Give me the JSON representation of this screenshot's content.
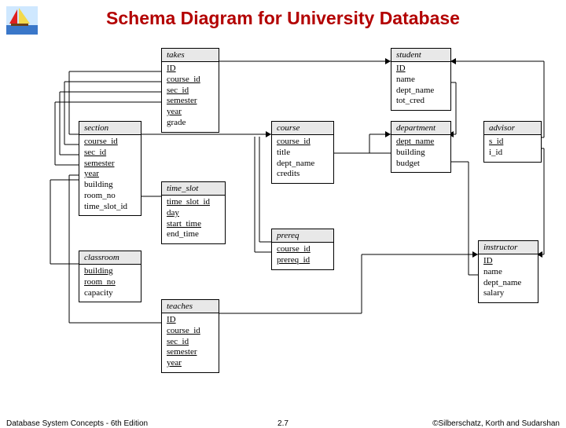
{
  "title": "Schema Diagram for University Database",
  "footer": {
    "left": "Database System Concepts - 6th Edition",
    "mid": "2.7",
    "right": "©Silberschatz, Korth and Sudarshan"
  },
  "entities": {
    "takes": {
      "name": "takes",
      "attrs": [
        "ID",
        "course_id",
        "sec_id",
        "semester",
        "year",
        "grade"
      ],
      "pk": [
        0,
        1,
        2,
        3,
        4
      ]
    },
    "student": {
      "name": "student",
      "attrs": [
        "ID",
        "name",
        "dept_name",
        "tot_cred"
      ],
      "pk": [
        0
      ]
    },
    "section": {
      "name": "section",
      "attrs": [
        "course_id",
        "sec_id",
        "semester",
        "year",
        "building",
        "room_no",
        "time_slot_id"
      ],
      "pk": [
        0,
        1,
        2,
        3
      ]
    },
    "course": {
      "name": "course",
      "attrs": [
        "course_id",
        "title",
        "dept_name",
        "credits"
      ],
      "pk": [
        0
      ]
    },
    "department": {
      "name": "department",
      "attrs": [
        "dept_name",
        "building",
        "budget"
      ],
      "pk": [
        0
      ]
    },
    "advisor": {
      "name": "advisor",
      "attrs": [
        "s_id",
        "i_id"
      ],
      "pk": [
        0
      ]
    },
    "time_slot": {
      "name": "time_slot",
      "attrs": [
        "time_slot_id",
        "day",
        "start_time",
        "end_time"
      ],
      "pk": [
        0,
        1,
        2
      ]
    },
    "prereq": {
      "name": "prereq",
      "attrs": [
        "course_id",
        "prereq_id"
      ],
      "pk": [
        0,
        1
      ]
    },
    "instructor": {
      "name": "instructor",
      "attrs": [
        "ID",
        "name",
        "dept_name",
        "salary"
      ],
      "pk": [
        0
      ]
    },
    "classroom": {
      "name": "classroom",
      "attrs": [
        "building",
        "room_no",
        "capacity"
      ],
      "pk": [
        0,
        1
      ]
    },
    "teaches": {
      "name": "teaches",
      "attrs": [
        "ID",
        "course_id",
        "sec_id",
        "semester",
        "year"
      ],
      "pk": [
        0,
        1,
        2,
        3,
        4
      ]
    }
  }
}
